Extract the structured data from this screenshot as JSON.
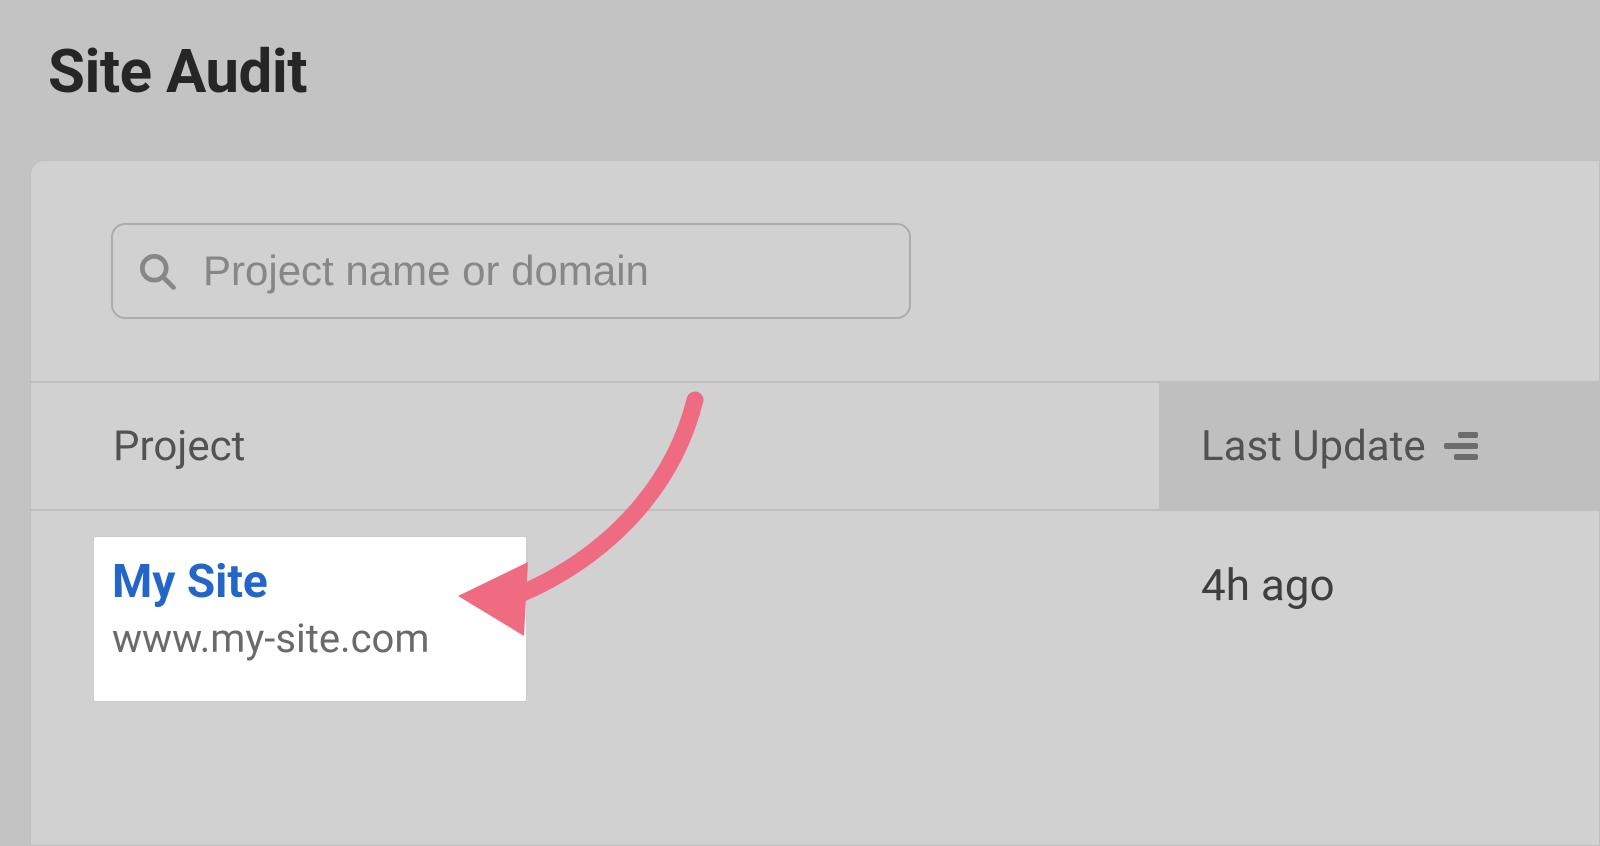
{
  "page": {
    "title": "Site Audit"
  },
  "search": {
    "placeholder": "Project name or domain"
  },
  "table": {
    "headers": {
      "project": "Project",
      "last_update": "Last Update"
    },
    "rows": [
      {
        "name": "My Site",
        "domain": "www.my-site.com",
        "last_update": "4h ago"
      }
    ]
  },
  "colors": {
    "link": "#2366c9",
    "annotation": "#ef6b82"
  }
}
